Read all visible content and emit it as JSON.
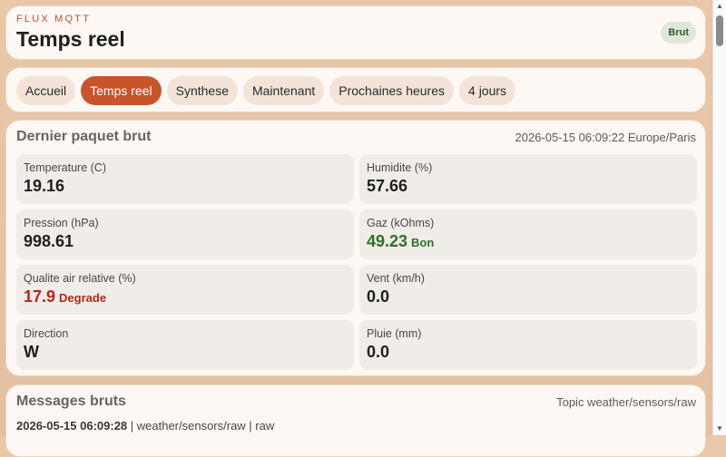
{
  "header": {
    "kicker": "FLUX MQTT",
    "title": "Temps reel",
    "badge": "Brut"
  },
  "nav": {
    "tabs": [
      {
        "label": "Accueil"
      },
      {
        "label": "Temps reel",
        "active": true
      },
      {
        "label": "Synthese"
      },
      {
        "label": "Maintenant"
      },
      {
        "label": "Prochaines heures"
      },
      {
        "label": "4 jours"
      }
    ]
  },
  "packet": {
    "title": "Dernier paquet brut",
    "timestamp": "2026-05-15 06:09:22 Europe/Paris",
    "metrics": [
      {
        "label": "Temperature (C)",
        "value": "19.16"
      },
      {
        "label": "Humidite (%)",
        "value": "57.66"
      },
      {
        "label": "Pression (hPa)",
        "value": "998.61"
      },
      {
        "label": "Gaz (kOhms)",
        "value": "49.23",
        "tag": "Bon",
        "status": "good"
      },
      {
        "label": "Qualite air relative (%)",
        "value": "17.9",
        "tag": "Degrade",
        "status": "bad"
      },
      {
        "label": "Vent (km/h)",
        "value": "0.0"
      },
      {
        "label": "Direction",
        "value": "W"
      },
      {
        "label": "Pluie (mm)",
        "value": "0.0"
      }
    ]
  },
  "messages": {
    "title": "Messages bruts",
    "topic": "Topic weather/sensors/raw",
    "entry": {
      "time": "2026-05-15 06:09:28",
      "rest": " | weather/sensors/raw | raw"
    }
  },
  "colors": {
    "accent": "#c8542b",
    "good": "#2f6f2a",
    "bad": "#b2281f",
    "badge_bg": "#dfe7da"
  }
}
